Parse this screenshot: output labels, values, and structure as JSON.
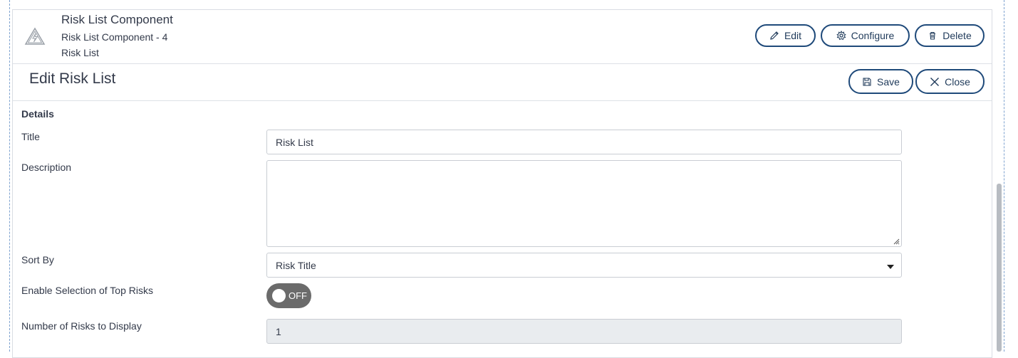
{
  "component": {
    "title": "Risk List Component",
    "subtitle": "Risk List Component - 4",
    "type": "Risk List",
    "icon": "warning-triangle-icon"
  },
  "toolbar": {
    "edit_label": "Edit",
    "configure_label": "Configure",
    "delete_label": "Delete"
  },
  "edit_panel": {
    "title": "Edit Risk List",
    "save_label": "Save",
    "close_label": "Close"
  },
  "form": {
    "section": "Details",
    "title_label": "Title",
    "title_value": "Risk List",
    "description_label": "Description",
    "description_value": "",
    "sort_label": "Sort By",
    "sort_value": "Risk Title",
    "toggle_label": "Enable Selection of Top Risks",
    "toggle_state": "OFF",
    "count_label": "Number of Risks to Display",
    "count_value": "1"
  },
  "colors": {
    "button_border": "#1f4a7a",
    "toggle_off": "#6b6b6b",
    "disabled_bg": "#e9ecef"
  }
}
